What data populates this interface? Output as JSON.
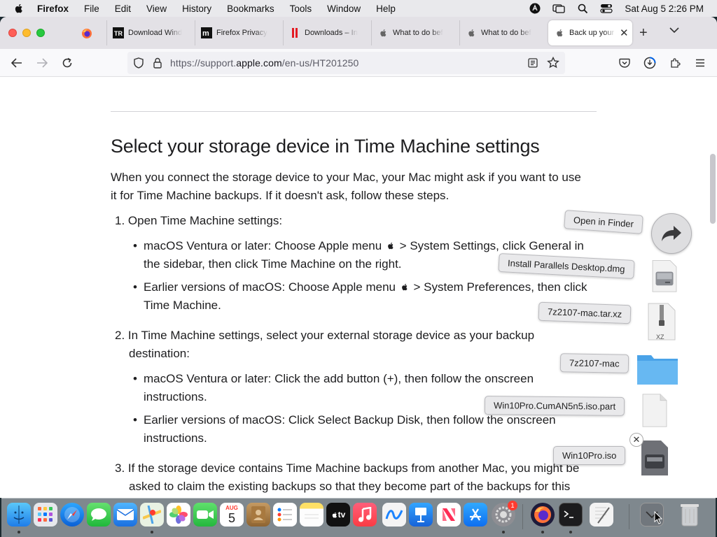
{
  "menubar": {
    "app": "Firefox",
    "items": [
      "File",
      "Edit",
      "View",
      "History",
      "Bookmarks",
      "Tools",
      "Window",
      "Help"
    ],
    "clock": "Sat Aug 5  2:26 PM"
  },
  "tabs": [
    {
      "title": "Download Wind",
      "icon": "techrepublic-favicon"
    },
    {
      "title": "Firefox Privacy",
      "icon": "mozilla-favicon"
    },
    {
      "title": "Downloads – In",
      "icon": "parallels-favicon"
    },
    {
      "title": "What to do bef",
      "icon": "apple-favicon"
    },
    {
      "title": "What to do bef",
      "icon": "apple-favicon"
    },
    {
      "title": "Back up your",
      "icon": "apple-favicon",
      "active": true
    }
  ],
  "url": {
    "prefix": "https://support.",
    "domain": "apple.com",
    "path": "/en-us/HT201250"
  },
  "article": {
    "heading": "Select your storage device in Time Machine settings",
    "intro_l1": "When you connect the storage device to your Mac, your Mac might ask if you want to use",
    "intro_l2": "it for Time Machine backups. If it doesn't ask, follow these steps.",
    "step1": "1. Open Time Machine settings:",
    "step1_b1_pre": "macOS Ventura or later: Choose Apple menu",
    "step1_b1_post": "> System Settings, click General in",
    "step1_b1_l2": "the sidebar, then click Time Machine on the right.",
    "step1_b2_pre": "Earlier versions of macOS: Choose Apple menu",
    "step1_b2_post": "> System Preferences, then click",
    "step1_b2_l2": "Time Machine.",
    "step2_l1": "2. In Time Machine settings, select your external storage device as your backup",
    "step2_l2": "destination:",
    "step2_b1_l1": "macOS Ventura or later: Click the add button (+), then follow the onscreen",
    "step2_b1_l2": "instructions.",
    "step2_b2_l1": "Earlier versions of macOS: Click Select Backup Disk, then follow the onscreen",
    "step2_b2_l2": "instructions.",
    "step3_l1": "3. If the storage device contains Time Machine backups from another Mac, you might be",
    "step3_l2": "asked to claim the existing backups so that they become part of the backups for this"
  },
  "downloads_stack": {
    "open_in_finder": "Open in Finder",
    "items": [
      "Install Parallels Desktop.dmg",
      "7z2107-mac.tar.xz",
      "7z2107-mac",
      "Win10Pro.CumAN5n5.iso.part",
      "Win10Pro.iso"
    ],
    "xz_label": "XZ"
  },
  "dock": {
    "calendar_month": "AUG",
    "calendar_day": "5",
    "tv_label": "tv",
    "settings_badge": "1"
  }
}
